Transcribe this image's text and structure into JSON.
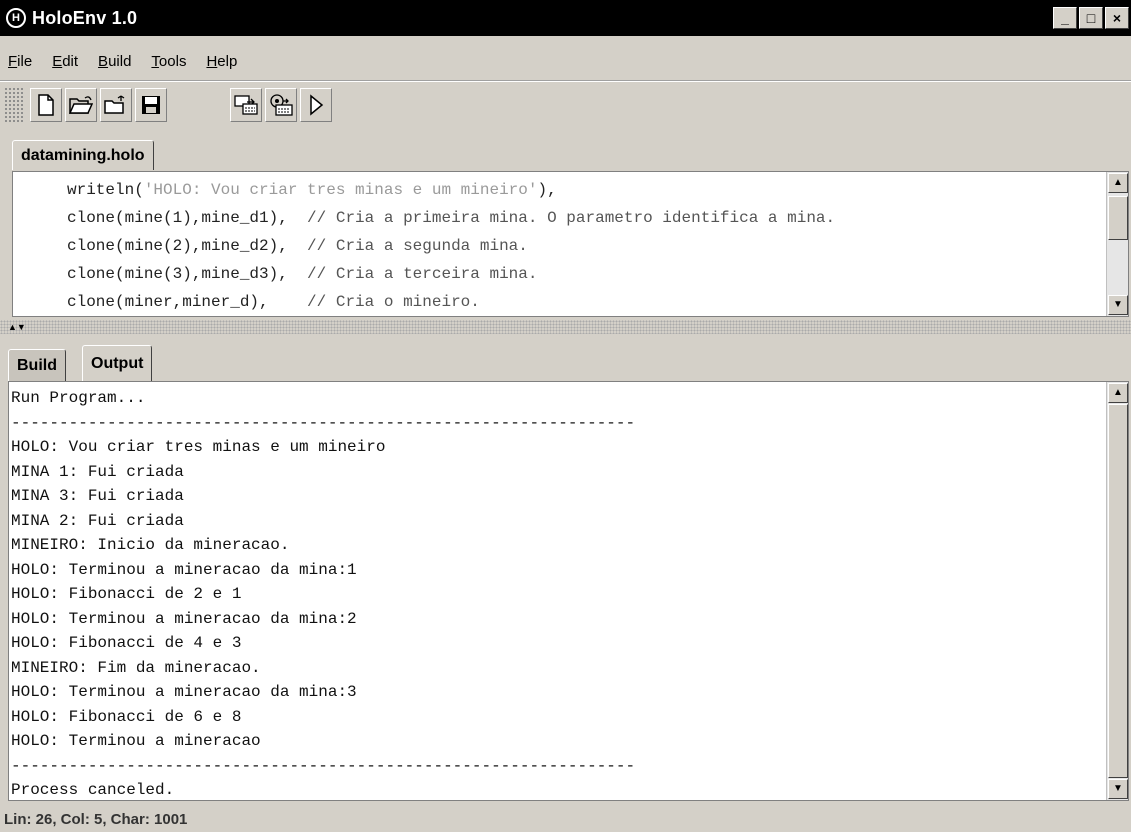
{
  "window": {
    "title": "HoloEnv 1.0",
    "minimize": "_",
    "maximize": "□",
    "close": "×"
  },
  "menu": [
    {
      "mnemonic": "F",
      "rest": "ile"
    },
    {
      "mnemonic": "E",
      "rest": "dit"
    },
    {
      "mnemonic": "B",
      "rest": "uild"
    },
    {
      "mnemonic": "T",
      "rest": "ools"
    },
    {
      "mnemonic": "H",
      "rest": "elp"
    }
  ],
  "toolbar": {
    "buttons": [
      "new-file-icon",
      "open-folder-icon",
      "open-recent-icon",
      "save-icon",
      "compile-icon",
      "build-icon",
      "run-icon"
    ]
  },
  "editor": {
    "tab": "datamining.holo",
    "lines": [
      {
        "code": "writeln(",
        "str": "'HOLO: Vou criar tres minas e um mineiro'",
        "tail": "),",
        "comment": ""
      },
      {
        "code": "clone(mine(1),mine_d1),  ",
        "str": "",
        "tail": "",
        "comment": "// Cria a primeira mina. O parametro identifica a mina."
      },
      {
        "code": "clone(mine(2),mine_d2),  ",
        "str": "",
        "tail": "",
        "comment": "// Cria a segunda mina."
      },
      {
        "code": "clone(mine(3),mine_d3),  ",
        "str": "",
        "tail": "",
        "comment": "// Cria a terceira mina."
      },
      {
        "code": "clone(miner,miner_d),    ",
        "str": "",
        "tail": "",
        "comment": "// Cria o mineiro."
      }
    ]
  },
  "output_panel": {
    "tabs": [
      "Build",
      "Output"
    ],
    "lines": [
      "Run Program...",
      "-----------------------------------------------------------------",
      "HOLO: Vou criar tres minas e um mineiro",
      "MINA 1: Fui criada",
      "MINA 3: Fui criada",
      "MINA 2: Fui criada",
      "MINEIRO: Inicio da mineracao.",
      "HOLO: Terminou a mineracao da mina:1",
      "HOLO: Fibonacci de 2 e 1",
      "HOLO: Terminou a mineracao da mina:2",
      "HOLO: Fibonacci de 4 e 3",
      "MINEIRO: Fim da mineracao.",
      "HOLO: Terminou a mineracao da mina:3",
      "HOLO: Fibonacci de 6 e 8",
      "HOLO: Terminou a mineracao",
      "-----------------------------------------------------------------",
      "Process canceled."
    ]
  },
  "status": "Lin: 26, Col: 5, Char: 1001"
}
